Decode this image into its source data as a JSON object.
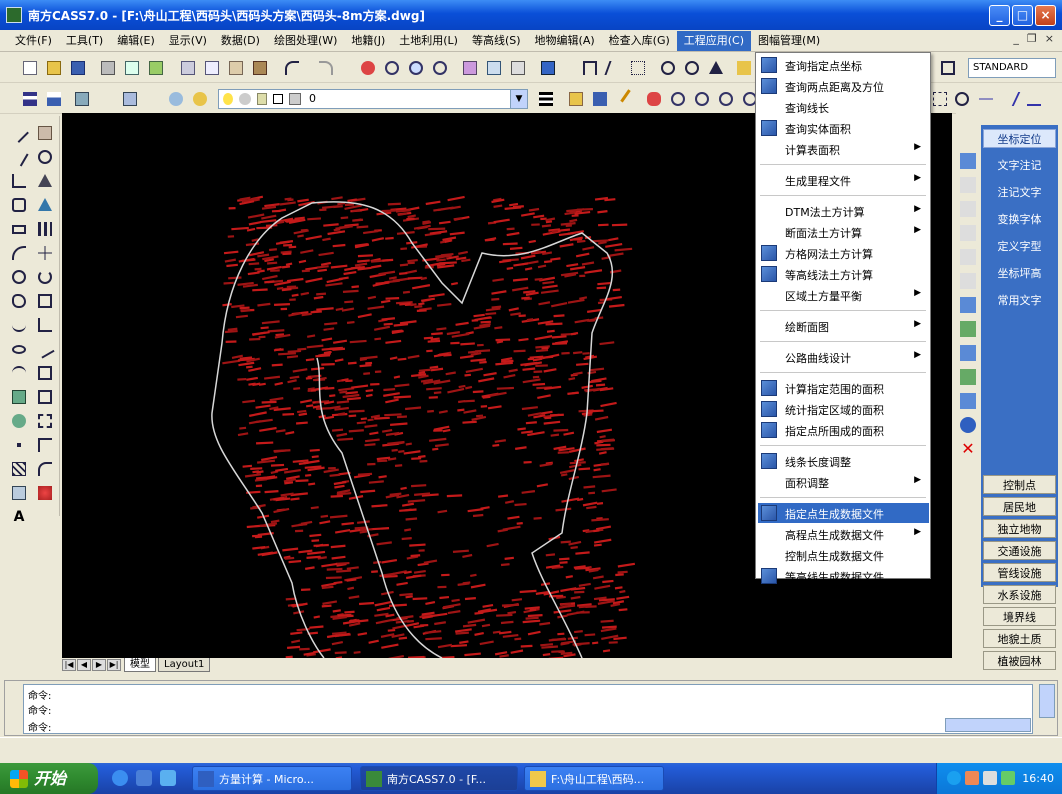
{
  "window": {
    "title": "南方CASS7.0 - [F:\\舟山工程\\西码头\\西码头方案\\西码头-8m方案.dwg]",
    "buttons": {
      "minimize": "_",
      "maximize": "□",
      "close": "×"
    }
  },
  "menubar": {
    "items": [
      {
        "label": "文件(F)"
      },
      {
        "label": "工具(T)"
      },
      {
        "label": "编辑(E)"
      },
      {
        "label": "显示(V)"
      },
      {
        "label": "数据(D)"
      },
      {
        "label": "绘图处理(W)"
      },
      {
        "label": "地籍(J)"
      },
      {
        "label": "土地利用(L)"
      },
      {
        "label": "等高线(S)"
      },
      {
        "label": "地物编辑(A)"
      },
      {
        "label": "检查入库(G)"
      },
      {
        "label": "工程应用(C)"
      },
      {
        "label": "图幅管理(M)"
      }
    ],
    "active_index": 11,
    "doc_controls": {
      "minimize": "_",
      "restore": "❐",
      "close": "×"
    }
  },
  "toolbar2": {
    "layer_value": "0",
    "text_style": "STANDARD"
  },
  "dropdown": {
    "items": [
      {
        "label": "查询指定点坐标",
        "icon": "coordinate-query-icon",
        "sub": false
      },
      {
        "label": "查询两点距离及方位",
        "icon": "distance-query-icon",
        "sub": false
      },
      {
        "label": "查询线长",
        "icon": "",
        "sub": false
      },
      {
        "label": "查询实体面积",
        "icon": "area-query-icon",
        "sub": false
      },
      {
        "label": "计算表面积",
        "icon": "",
        "sub": true
      },
      {
        "sep": true
      },
      {
        "label": "生成里程文件",
        "icon": "",
        "sub": true
      },
      {
        "sep": true
      },
      {
        "label": "DTM法土方计算",
        "icon": "",
        "sub": true
      },
      {
        "label": "断面法土方计算",
        "icon": "",
        "sub": true
      },
      {
        "label": "方格网法土方计算",
        "icon": "grid-earthwork-icon",
        "sub": false
      },
      {
        "label": "等高线法土方计算",
        "icon": "contour-earthwork-icon",
        "sub": false
      },
      {
        "label": "区域土方量平衡",
        "icon": "",
        "sub": true
      },
      {
        "sep": true
      },
      {
        "label": "绘断面图",
        "icon": "",
        "sub": true
      },
      {
        "sep": true
      },
      {
        "label": "公路曲线设计",
        "icon": "",
        "sub": true
      },
      {
        "sep": true
      },
      {
        "label": "计算指定范围的面积",
        "icon": "range-area-icon",
        "sub": false
      },
      {
        "label": "统计指定区域的面积",
        "icon": "region-stats-icon",
        "sub": false
      },
      {
        "label": "指定点所围成的面积",
        "icon": "point-area-icon",
        "sub": false
      },
      {
        "sep": true
      },
      {
        "label": "线条长度调整",
        "icon": "line-adjust-icon",
        "sub": false
      },
      {
        "label": "面积调整",
        "icon": "",
        "sub": true
      },
      {
        "sep": true
      },
      {
        "label": "指定点生成数据文件",
        "icon": "point-datafile-icon",
        "sub": false,
        "highlight": true
      },
      {
        "label": "高程点生成数据文件",
        "icon": "",
        "sub": true
      },
      {
        "label": "控制点生成数据文件",
        "icon": "",
        "sub": false
      },
      {
        "label": "等高线生成数据文件",
        "icon": "contour-datafile-icon",
        "sub": false
      }
    ]
  },
  "right_panel": {
    "top_buttons": [
      "坐标定位",
      "文字注记",
      "注记文字",
      "变换字体",
      "定义字型",
      "坐标坪高",
      "常用文字"
    ],
    "categories": [
      "控制点",
      "居民地",
      "独立地物",
      "交通设施",
      "管线设施",
      "水系设施",
      "境界线",
      "地貌土质",
      "植被园林"
    ]
  },
  "layout_tabs": [
    "模型",
    "Layout1"
  ],
  "command": {
    "lines": [
      "命令:",
      "命令:",
      "命令:"
    ]
  },
  "taskbar": {
    "start_label": "开始",
    "tasks": [
      {
        "label": "方量计算 - Micro...",
        "icon": "word-icon",
        "active": false
      },
      {
        "label": "南方CASS7.0 - [F...",
        "icon": "cass-icon",
        "active": true
      },
      {
        "label": "F:\\舟山工程\\西码...",
        "icon": "folder-icon",
        "active": false
      }
    ],
    "clock": "16:40"
  }
}
